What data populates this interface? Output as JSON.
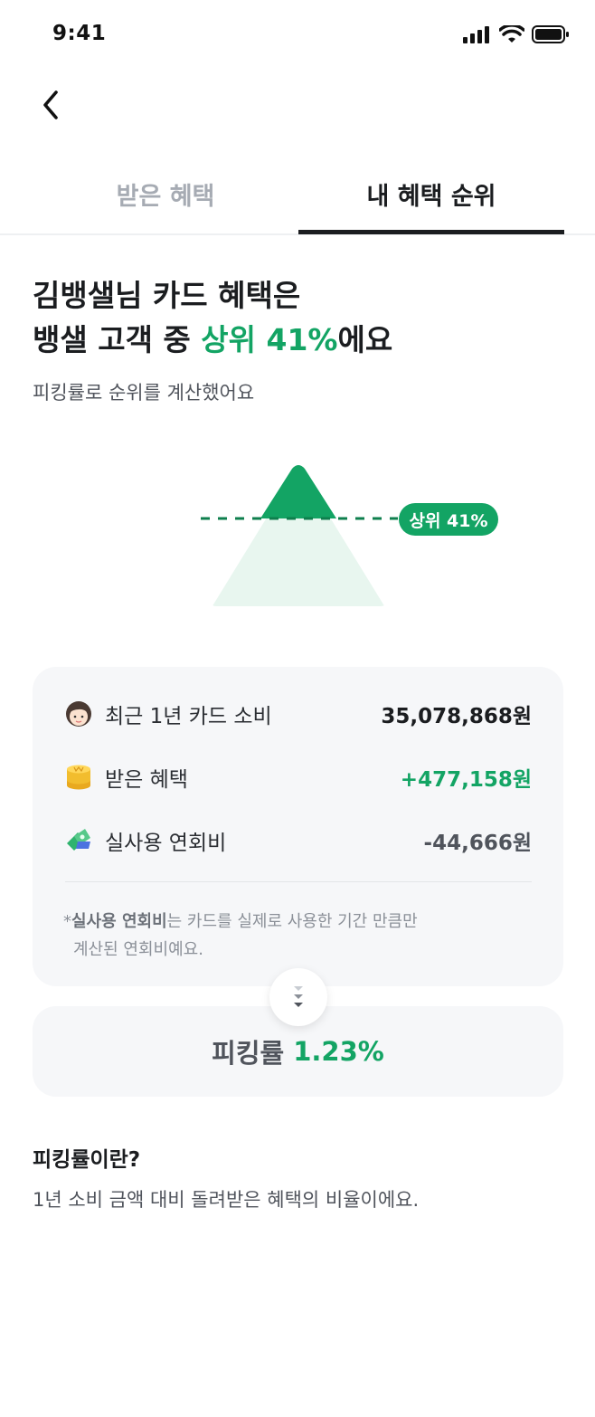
{
  "status_bar": {
    "time": "9:41",
    "icons": [
      "signal-icon",
      "wifi-icon",
      "battery-icon"
    ]
  },
  "nav": {
    "back_icon": "chevron-left-icon"
  },
  "tabs": [
    {
      "label": "받은 혜택",
      "active": false
    },
    {
      "label": "내 혜택 순위",
      "active": true
    }
  ],
  "headline": {
    "line1": "김뱅샐님 카드 혜택은",
    "line2_prefix": "뱅샐 고객 중 ",
    "line2_accent": "상위 41%",
    "line2_suffix": "에요"
  },
  "subtext": "피킹률로 순위를 계산했어요",
  "rank": {
    "badge": "상위 41%",
    "percentile": 41
  },
  "summary": {
    "rows": [
      {
        "icon": "person-face-icon",
        "label": "최근 1년 카드 소비",
        "value": "35,078,868원"
      },
      {
        "icon": "coin-stack-icon",
        "label": "받은 혜택",
        "value": "+477,158원"
      },
      {
        "icon": "card-fee-icon",
        "label": "실사용 연회비",
        "value": "-44,666원"
      }
    ],
    "footnote": {
      "prefix": "*",
      "bold": "실사용 연회비",
      "line1_rest": "는 카드를 실제로 사용한 기간 만큼만",
      "line2": "계산된 연회비예요."
    }
  },
  "rate": {
    "label": "피킹률",
    "value": "1.23%"
  },
  "explain": {
    "title": "피킹률이란?",
    "text": "1년 소비 금액 대비 돌려받은 혜택의 비율이에요."
  },
  "colors": {
    "accent": "#13a464",
    "accent_light": "#e8f6ef",
    "text_primary": "#1b1d20",
    "text_secondary": "#50545c",
    "card_bg": "#f6f7f9"
  }
}
